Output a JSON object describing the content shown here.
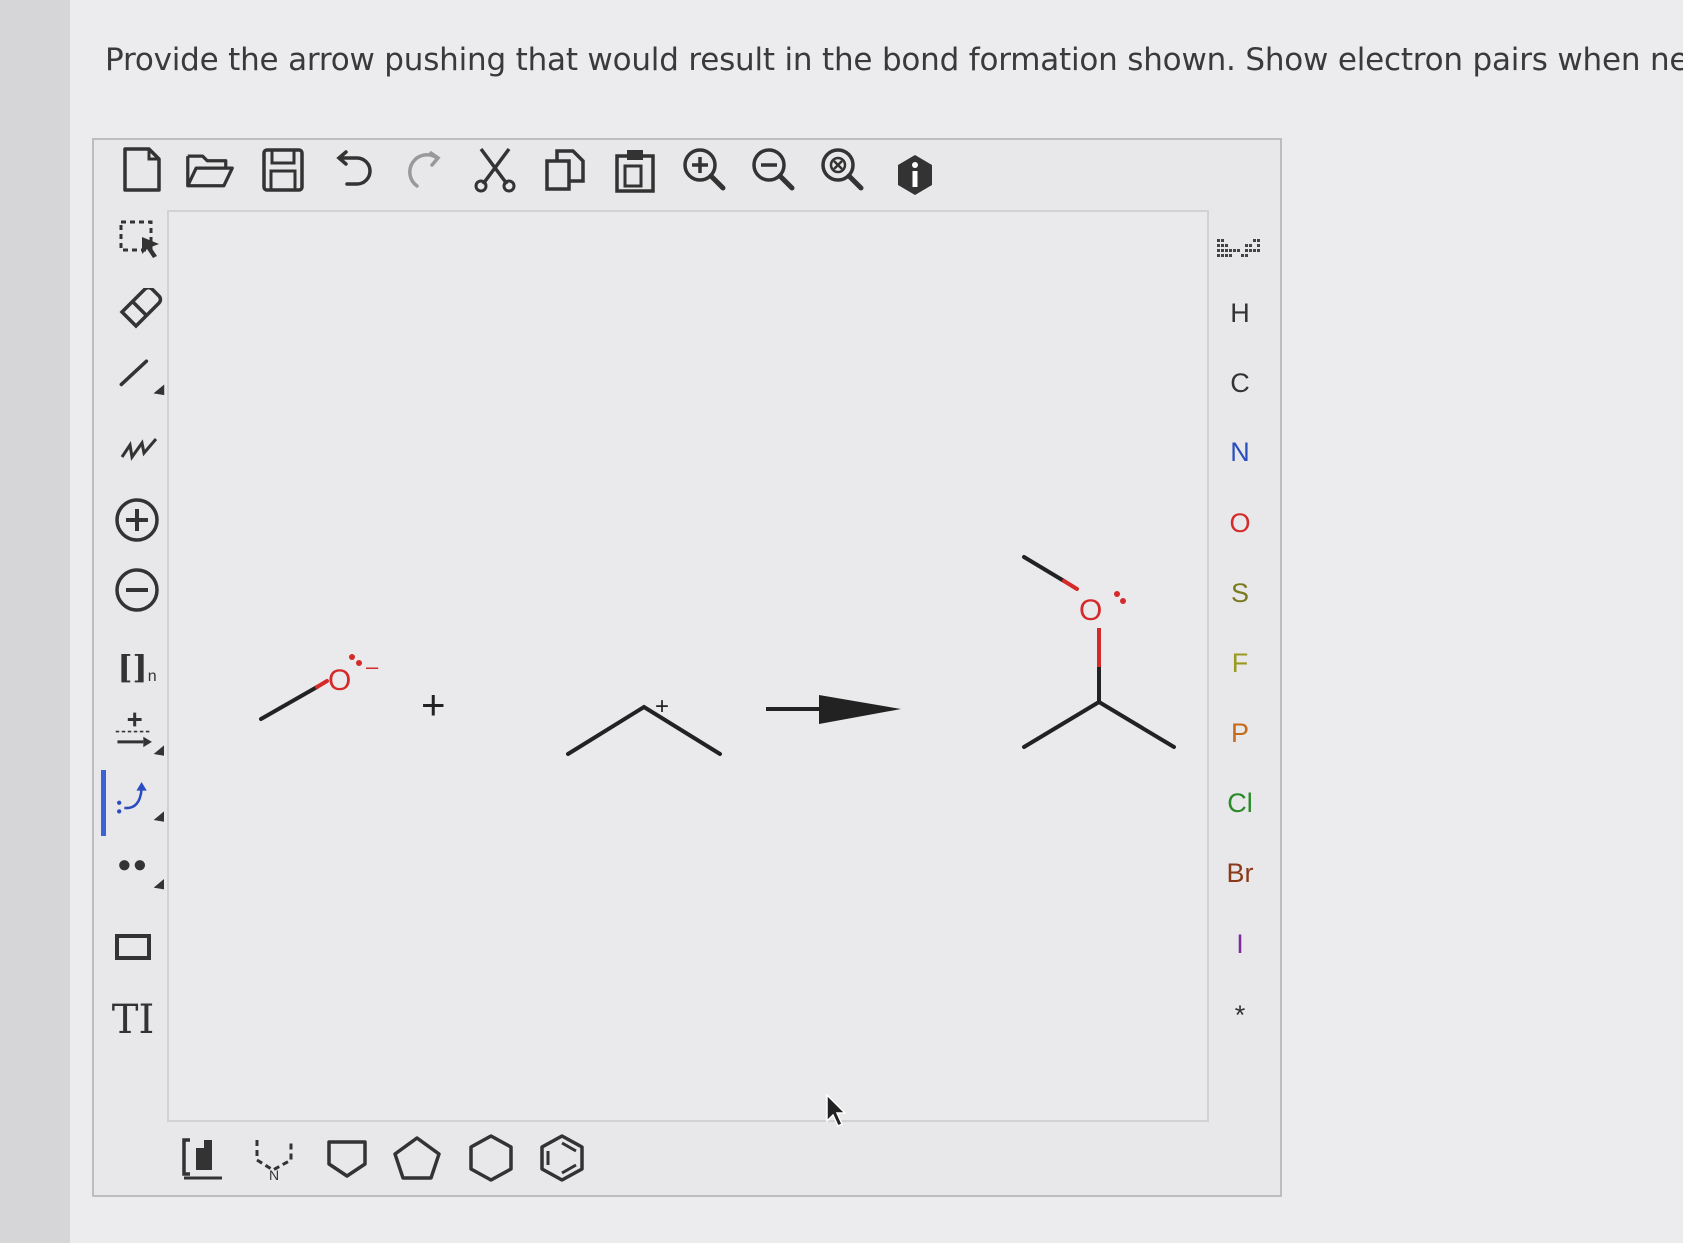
{
  "question": "Provide the arrow pushing that would result in the bond formation shown. Show electron pairs when needed",
  "top_toolbar": [
    {
      "name": "new-document-icon"
    },
    {
      "name": "open-folder-icon"
    },
    {
      "name": "save-icon"
    },
    {
      "name": "undo-icon"
    },
    {
      "name": "redo-icon"
    },
    {
      "name": "cut-icon"
    },
    {
      "name": "copy-icon"
    },
    {
      "name": "paste-icon"
    },
    {
      "name": "zoom-in-icon"
    },
    {
      "name": "zoom-out-icon"
    },
    {
      "name": "zoom-reset-icon"
    },
    {
      "name": "info-icon"
    }
  ],
  "left_toolbar": {
    "polymer_label": "[]",
    "polymer_sub": "n",
    "text_tool_label": "T",
    "plus_label": "+"
  },
  "elements": [
    {
      "symbol": "H",
      "color": "#333333"
    },
    {
      "symbol": "C",
      "color": "#333333"
    },
    {
      "symbol": "N",
      "color": "#2a4dbf"
    },
    {
      "symbol": "O",
      "color": "#d42a2a"
    },
    {
      "symbol": "S",
      "color": "#7a7a20"
    },
    {
      "symbol": "F",
      "color": "#9a9a20"
    },
    {
      "symbol": "P",
      "color": "#c56a1a"
    },
    {
      "symbol": "Cl",
      "color": "#2a8a2a"
    },
    {
      "symbol": "Br",
      "color": "#8a3a1a"
    },
    {
      "symbol": "I",
      "color": "#7a2a9a"
    },
    {
      "symbol": "*",
      "color": "#333333"
    }
  ],
  "canvas": {
    "reactant1_atom": "O",
    "reactant1_charge": "–",
    "plus_sign": "+",
    "reactant2_charge": "+",
    "product_atom": "O"
  },
  "bottom_templates": [
    {
      "name": "template-library-icon"
    },
    {
      "name": "template-n-ring-icon",
      "label": "N"
    },
    {
      "name": "cyclobutane-icon"
    },
    {
      "name": "cyclopentane-icon"
    },
    {
      "name": "cyclohexane-icon"
    },
    {
      "name": "benzene-icon"
    }
  ]
}
